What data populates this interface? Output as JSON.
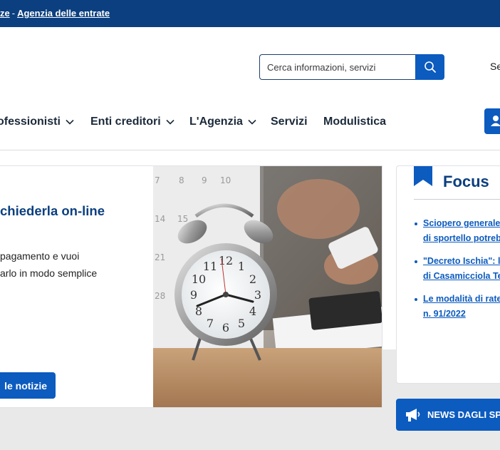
{
  "topbar": {
    "prefix": "ze",
    "separator": "-",
    "agency_link": "Agenzia delle entrate"
  },
  "search": {
    "placeholder": "Cerca informazioni, servizi"
  },
  "header": {
    "language_label": "Se"
  },
  "nav": {
    "items": [
      {
        "label": "ofessionisti",
        "dropdown": true
      },
      {
        "label": "Enti creditori",
        "dropdown": true
      },
      {
        "label": "L'Agenzia",
        "dropdown": true
      },
      {
        "label": "Servizi",
        "dropdown": false
      },
      {
        "label": "Modulistica",
        "dropdown": false
      }
    ]
  },
  "card": {
    "title": "chiederla on-line",
    "text_line1": "pagamento e vuoi",
    "text_line2": "arlo in modo semplice",
    "button_label": "le notizie"
  },
  "focus": {
    "title": "Focus",
    "items": [
      {
        "line1": "Sciopero generale",
        "line2": "di sportello potreb"
      },
      {
        "line1": "\"Decreto Ischia\": l",
        "line2": "di Casamicciola Te"
      },
      {
        "line1": "Le modalità di rate",
        "line2": "n. 91/2022"
      }
    ]
  },
  "news_button": {
    "label": "NEWS DAGLI SPO"
  },
  "colors": {
    "primary": "#0c5bbf",
    "header": "#0b3f7f",
    "background": "#e9e9e9"
  },
  "icons": [
    "search-icon",
    "chevron-down-icon",
    "user-icon",
    "bookmark-icon",
    "megaphone-icon"
  ]
}
